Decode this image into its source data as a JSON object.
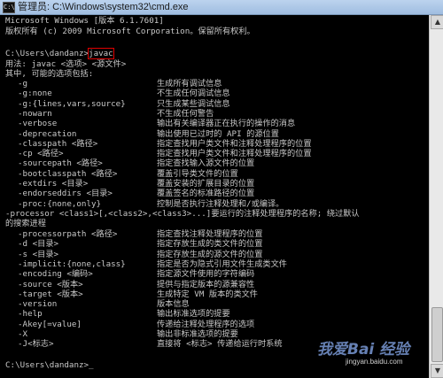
{
  "window": {
    "title": "管理员: C:\\Windows\\system32\\cmd.exe",
    "icon": "cmd-icon"
  },
  "console": {
    "header1": "Microsoft Windows [版本 6.1.7601]",
    "header2": "版权所有 (c) 2009 Microsoft Corporation。保留所有权利。",
    "prompt": "C:\\Users\\dandanz>",
    "command": "javac",
    "usage": "用法: javac <选项> <源文件>",
    "intro": "其中, 可能的选项包括:",
    "options": [
      {
        "opt": "-g",
        "desc": "生成所有调试信息"
      },
      {
        "opt": "-g:none",
        "desc": "不生成任何调试信息"
      },
      {
        "opt": "-g:{lines,vars,source}",
        "desc": "只生成某些调试信息"
      },
      {
        "opt": "-nowarn",
        "desc": "不生成任何警告"
      },
      {
        "opt": "-verbose",
        "desc": "输出有关编译器正在执行的操作的消息"
      },
      {
        "opt": "-deprecation",
        "desc": "输出使用已过时的 API 的源位置"
      },
      {
        "opt": "-classpath <路径>",
        "desc": "指定查找用户类文件和注释处理程序的位置"
      },
      {
        "opt": "-cp <路径>",
        "desc": "指定查找用户类文件和注释处理程序的位置"
      },
      {
        "opt": "-sourcepath <路径>",
        "desc": "指定查找输入源文件的位置"
      },
      {
        "opt": "-bootclasspath <路径>",
        "desc": "覆盖引导类文件的位置"
      },
      {
        "opt": "-extdirs <目录>",
        "desc": "覆盖安装的扩展目录的位置"
      },
      {
        "opt": "-endorseddirs <目录>",
        "desc": "覆盖签名的标准路径的位置"
      },
      {
        "opt": "-proc:{none,only}",
        "desc": "控制是否执行注释处理和/或编译。"
      }
    ],
    "processor_line1": "-processor <class1>[,<class2>,<class3>...]要运行的注释处理程序的名称; 绕过默认",
    "processor_line2": "的搜索进程",
    "options2": [
      {
        "opt": "-processorpath <路径>",
        "desc": "指定查找注释处理程序的位置"
      },
      {
        "opt": "-d <目录>",
        "desc": "指定存放生成的类文件的位置"
      },
      {
        "opt": "-s <目录>",
        "desc": "指定存放生成的源文件的位置"
      },
      {
        "opt": "-implicit:{none,class}",
        "desc": "指定是否为隐式引用文件生成类文件"
      },
      {
        "opt": "-encoding <编码>",
        "desc": "指定源文件使用的字符编码"
      },
      {
        "opt": "-source <版本>",
        "desc": "提供与指定版本的源兼容性"
      },
      {
        "opt": "-target <版本>",
        "desc": "生成特定 VM 版本的类文件"
      },
      {
        "opt": "-version",
        "desc": "版本信息"
      },
      {
        "opt": "-help",
        "desc": "输出标准选项的提要"
      },
      {
        "opt": "-Akey[=value]",
        "desc": "传递给注释处理程序的选项"
      },
      {
        "opt": "-X",
        "desc": "输出非标准选项的提要"
      },
      {
        "opt": "-J<标志>",
        "desc": "直接将 <标志> 传递给运行时系统"
      }
    ],
    "final_prompt": "C:\\Users\\dandanz>",
    "cursor": "_"
  },
  "watermark": {
    "text": "我爱Bai 经验",
    "url": "jingyan.baidu.com"
  },
  "scrollbar": {
    "up": "▲",
    "down": "▼"
  }
}
